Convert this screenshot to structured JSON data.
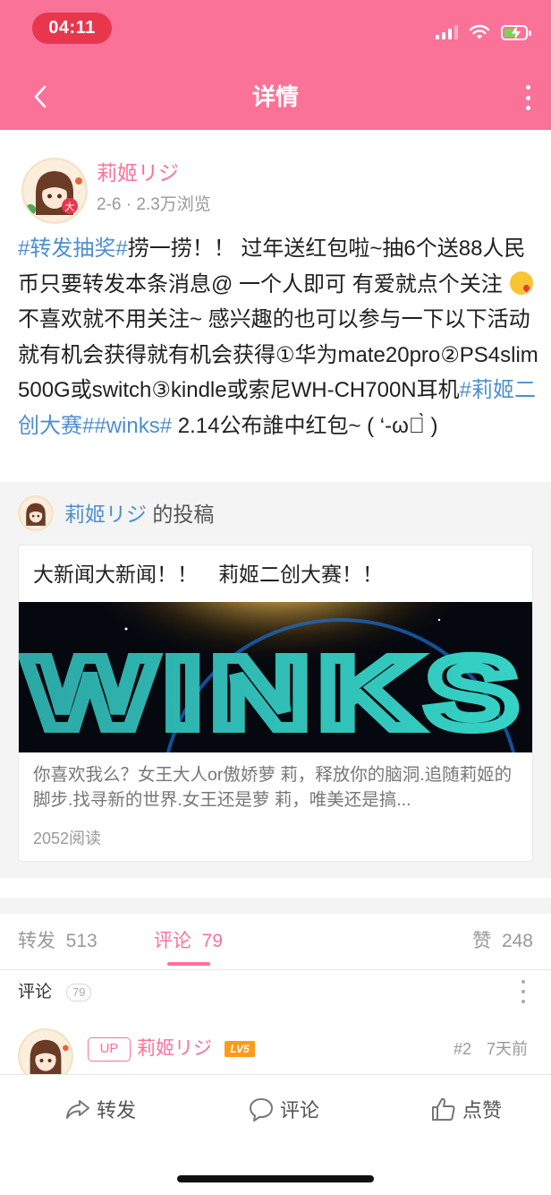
{
  "status_bar": {
    "time": "04:11"
  },
  "nav": {
    "title": "详情",
    "back_icon": "chevron-left-icon",
    "more_icon": "vertical-dots-icon"
  },
  "post": {
    "author": "莉姬リジ",
    "meta": "2-6 · 2.3万浏览",
    "segments": [
      {
        "text": "#转发抽奖#",
        "type": "tag"
      },
      {
        "text": "捞一捞！！ 过年送红包啦~抽6个送88人民币只要转发本条消息@ 一个人即可 有爱就点个关注 ",
        "type": "text"
      },
      {
        "text": "😘",
        "type": "emoji"
      },
      {
        "text": " 不喜欢就不用关注~ 感兴趣的也可以参与一下以下活动 就有机会获得就有机会获得①华为mate20pro②PS4slim500G或switch③kindle或索尼WH-CH700N耳机",
        "type": "text"
      },
      {
        "text": "#莉姬二创大赛#",
        "type": "tag"
      },
      {
        "text": "#winks#",
        "type": "tag"
      },
      {
        "text": "  2.14公布誰中红包~ ( ‘-ωก̀ )",
        "type": "text"
      }
    ]
  },
  "repost": {
    "author": "莉姬リジ",
    "suffix": "的投稿",
    "article_title": "大新闻大新闻！！　莉姬二创大赛！！",
    "banner_text": "WINKS",
    "description": "你喜欢我么？女王大人or傲娇萝 莉，释放你的脑洞.追随莉姬的脚步.找寻新的世界.女王还是萝 莉，唯美还是搞...",
    "reads": "2052阅读"
  },
  "stats": {
    "repost": {
      "label": "转发",
      "count": "513"
    },
    "comment": {
      "label": "评论",
      "count": "79"
    },
    "like": {
      "label": "赞",
      "count": "248"
    }
  },
  "comments": {
    "label": "评论",
    "count": "79",
    "first": {
      "badge": "UP",
      "name": "莉姬リジ",
      "level": "LV5",
      "floor": "#2",
      "time": "7天前"
    }
  },
  "actions": {
    "repost": {
      "label": "转发",
      "icon": "share-arrow-icon"
    },
    "comment": {
      "label": "评论",
      "icon": "speech-bubble-icon"
    },
    "like": {
      "label": "点赞",
      "icon": "thumbs-up-icon"
    }
  },
  "colors": {
    "brand_pink": "#fb7299",
    "tag_blue": "#4c8fd0",
    "time_pill": "#e8374d"
  }
}
